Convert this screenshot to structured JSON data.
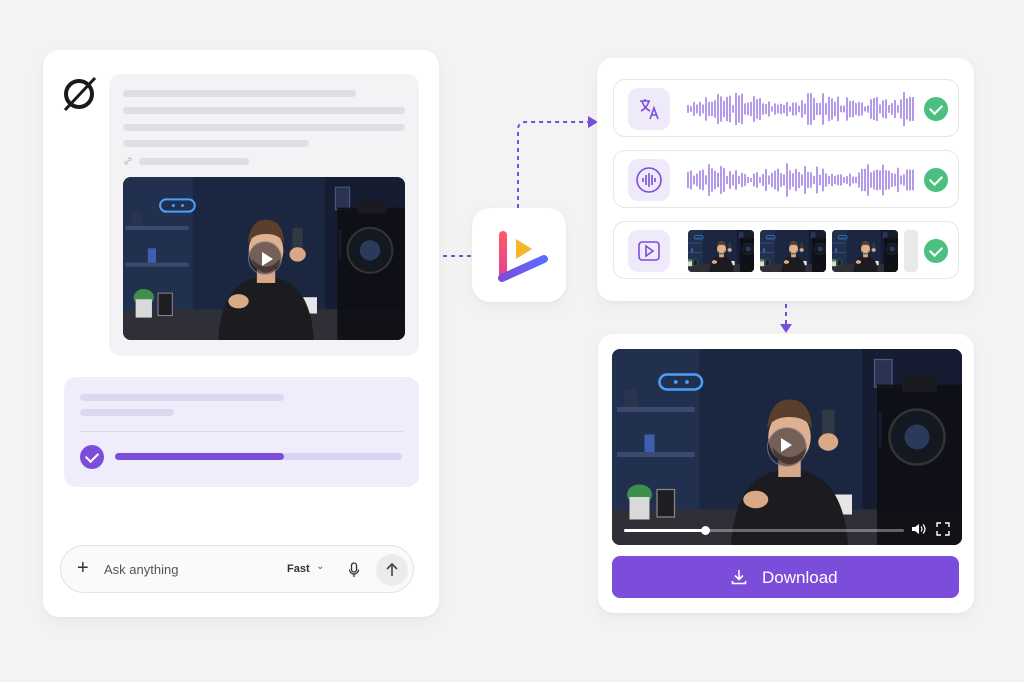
{
  "composer": {
    "plus_glyph": "+",
    "placeholder": "Ask anything",
    "mode_label": "Fast",
    "mode_chevron": "⌄"
  },
  "upload_progress": {
    "fraction": 0.59
  },
  "tracks": [
    {
      "kind": "translate",
      "icon": "translate-icon",
      "status": "complete"
    },
    {
      "kind": "audio",
      "icon": "audio-waveform-icon",
      "status": "complete"
    },
    {
      "kind": "video-frames",
      "icon": "video-play-icon",
      "status": "complete"
    }
  ],
  "player": {
    "progress": 0.29
  },
  "download": {
    "label": "Download"
  },
  "colors": {
    "accent": "#7c4ddb",
    "accent_light": "#efeaf9",
    "success": "#4bbf7f",
    "background": "#f3f3f4"
  }
}
